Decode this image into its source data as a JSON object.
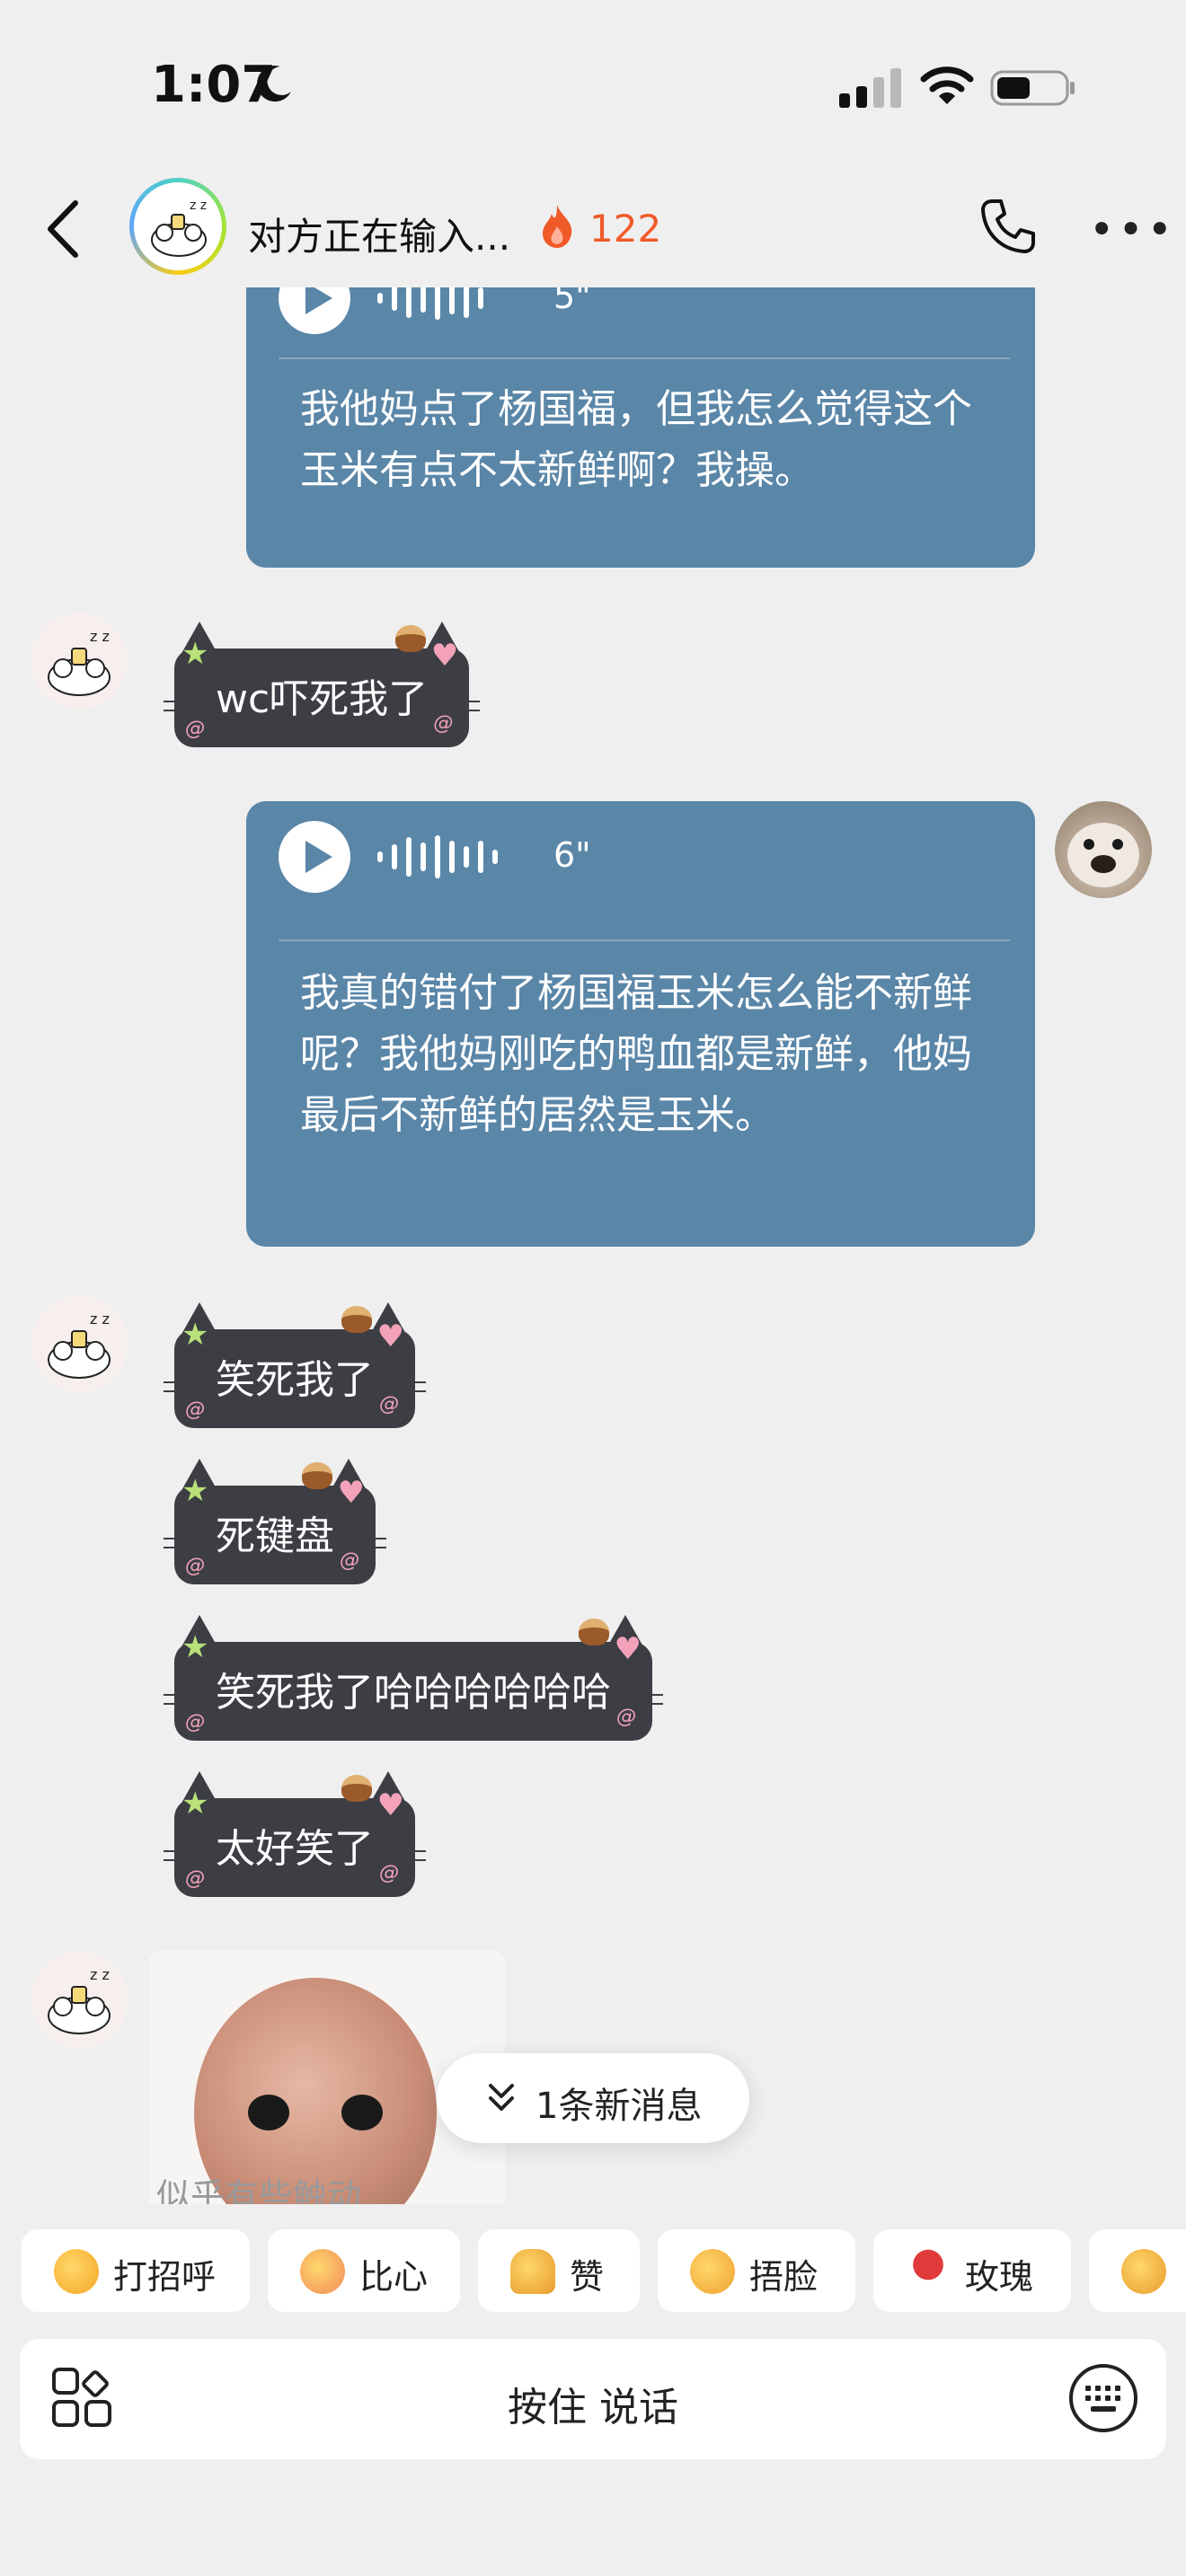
{
  "status_bar": {
    "time": "1:07",
    "moon_icon": "moon-icon",
    "signal_icon": "signal-icon",
    "wifi_icon": "wifi-icon",
    "battery_icon": "battery-icon"
  },
  "header": {
    "title": "对方正在输入...",
    "streak_count": "122",
    "streak_color": "#f05a28",
    "back_icon": "chevron-left-icon",
    "call_icon": "phone-icon",
    "more_icon": "more-icon"
  },
  "messages": {
    "m1": {
      "sender": "me",
      "type": "voice",
      "duration": "5\"",
      "transcript": "我他妈点了杨国福，但我怎么觉得这个玉米有点不太新鲜啊？我操。"
    },
    "m2": {
      "sender": "other",
      "type": "text",
      "text": "wc吓死我了"
    },
    "m3": {
      "sender": "me",
      "type": "voice",
      "duration": "6\"",
      "transcript": "我真的错付了杨国福玉米怎么能不新鲜呢？我他妈刚吃的鸭血都是新鲜，他妈最后不新鲜的居然是玉米。"
    },
    "m4": {
      "sender": "other",
      "type": "text",
      "text": "笑死我了"
    },
    "m5": {
      "sender": "other",
      "type": "text",
      "text": "死键盘"
    },
    "m6": {
      "sender": "other",
      "type": "text",
      "text": "笑死我了哈哈哈哈哈哈"
    },
    "m7": {
      "sender": "other",
      "type": "text",
      "text": "太好笑了"
    },
    "m8": {
      "sender": "other",
      "type": "sticker",
      "caption": "似乎有些触动"
    }
  },
  "new_message_pill": {
    "label": "1条新消息"
  },
  "quick_replies": [
    {
      "emoji": "smiling-face-icon",
      "label": "打招呼"
    },
    {
      "emoji": "heart-hands-icon",
      "label": "比心"
    },
    {
      "emoji": "thumbs-up-icon",
      "label": "赞"
    },
    {
      "emoji": "facepalm-icon",
      "label": "捂脸"
    },
    {
      "emoji": "rose-icon",
      "label": "玫瑰"
    },
    {
      "emoji": "finger-heart-icon",
      "label": ""
    }
  ],
  "input_bar": {
    "hold_to_talk": "按住 说话",
    "apps_icon": "apps-grid-icon",
    "keyboard_icon": "keyboard-icon"
  },
  "colors": {
    "voice_bubble": "#5a86a8",
    "cat_bubble": "#3c3e44",
    "background": "#efefef"
  }
}
